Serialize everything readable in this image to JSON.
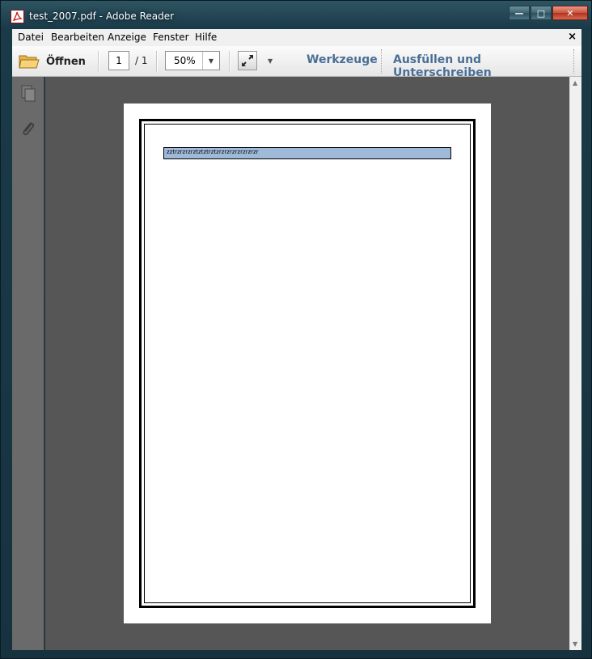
{
  "window": {
    "title": "test_2007.pdf - Adobe Reader",
    "buttons": {
      "minimize": "—",
      "maximize": "□",
      "close": "✕"
    }
  },
  "menu": {
    "items": [
      "Datei",
      "Bearbeiten",
      "Anzeige",
      "Fenster",
      "Hilfe"
    ],
    "close_doc": "×"
  },
  "toolbar": {
    "open_label": "Öffnen",
    "page_current": "1",
    "page_total": "/ 1",
    "zoom": "50%",
    "tools_label": "Werkzeuge",
    "fill_sign_label": "Ausfüllen und Unterschreiben"
  },
  "document": {
    "form_field_text": "zztrzrzrzrztztztrztzrzrzrzrzrzrzrzr"
  },
  "icons": {
    "folder": "folder-icon",
    "fit_page": "fit-page-icon",
    "pages_panel": "pages-icon",
    "attachments": "paperclip-icon"
  },
  "colors": {
    "doc_background": "#565656",
    "nav_panel": "#6a6a6a",
    "link": "#4a6f96",
    "form_field": "#9fb9d9"
  }
}
